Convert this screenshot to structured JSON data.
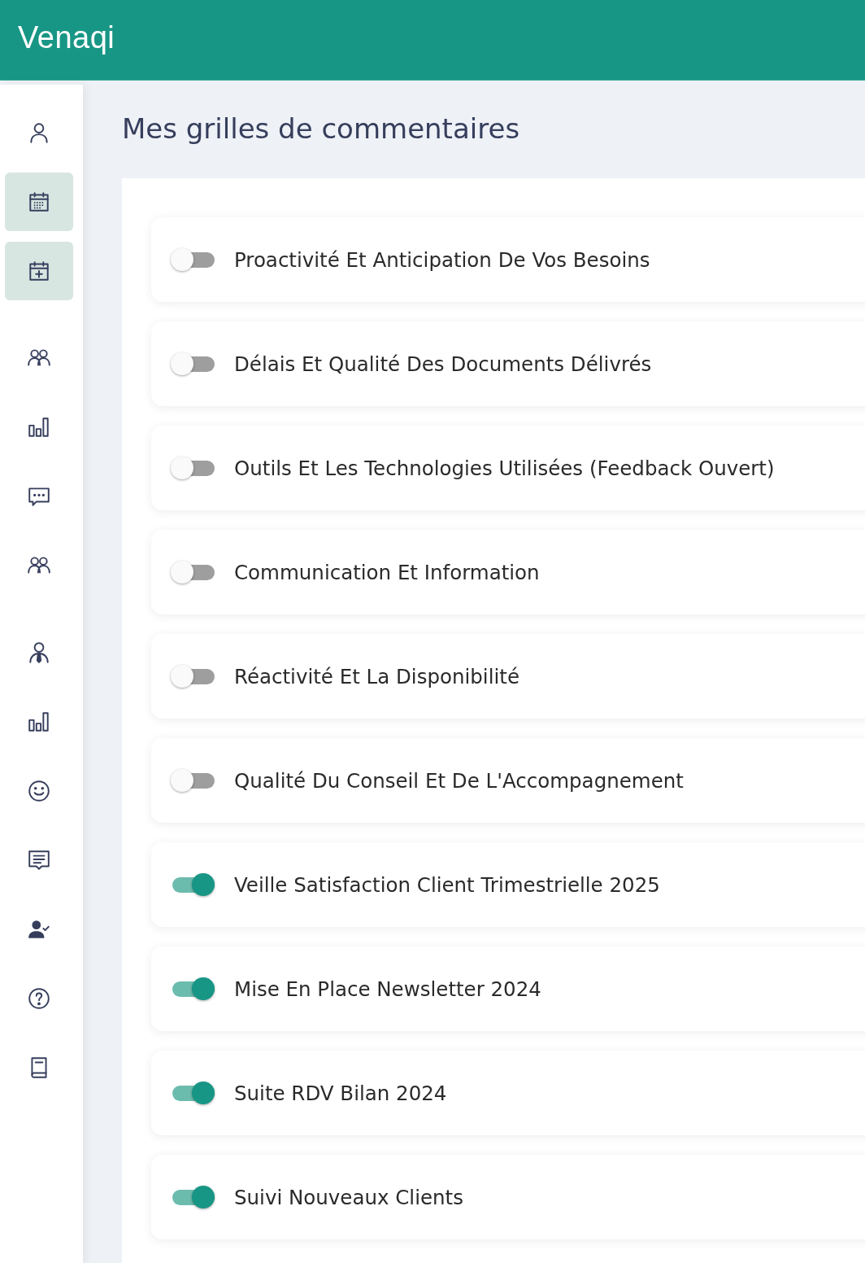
{
  "header": {
    "brand": "Venaqi"
  },
  "sidebar": {
    "groups": [
      {
        "items": [
          {
            "selected": false
          },
          {
            "selected": true
          },
          {
            "selected": true
          }
        ]
      },
      {
        "items": [
          {
            "selected": false
          },
          {
            "selected": false
          },
          {
            "selected": false
          },
          {
            "selected": false
          }
        ]
      },
      {
        "items": [
          {
            "selected": false
          },
          {
            "selected": false
          },
          {
            "selected": false
          },
          {
            "selected": false
          },
          {
            "selected": false
          },
          {
            "selected": false
          },
          {
            "selected": false
          }
        ]
      }
    ]
  },
  "page": {
    "title": "Mes grilles de commentaires"
  },
  "grids": [
    {
      "name": "Proactivité Et Anticipation De Vos Besoins",
      "on": false
    },
    {
      "name": "Délais Et Qualité Des Documents Délivrés",
      "on": false
    },
    {
      "name": "Outils Et Les Technologies Utilisées (Feedback Ouvert)",
      "on": false
    },
    {
      "name": "Communication Et Information",
      "on": false
    },
    {
      "name": "Réactivité Et La Disponibilité",
      "on": false
    },
    {
      "name": "Qualité Du Conseil Et De L'Accompagnement",
      "on": false
    },
    {
      "name": "Veille Satisfaction Client Trimestrielle 2025",
      "on": true
    },
    {
      "name": "Mise En Place Newsletter 2024",
      "on": true
    },
    {
      "name": "Suite RDV Bilan 2024",
      "on": true
    },
    {
      "name": "Suivi Nouveaux Clients",
      "on": true
    }
  ]
}
